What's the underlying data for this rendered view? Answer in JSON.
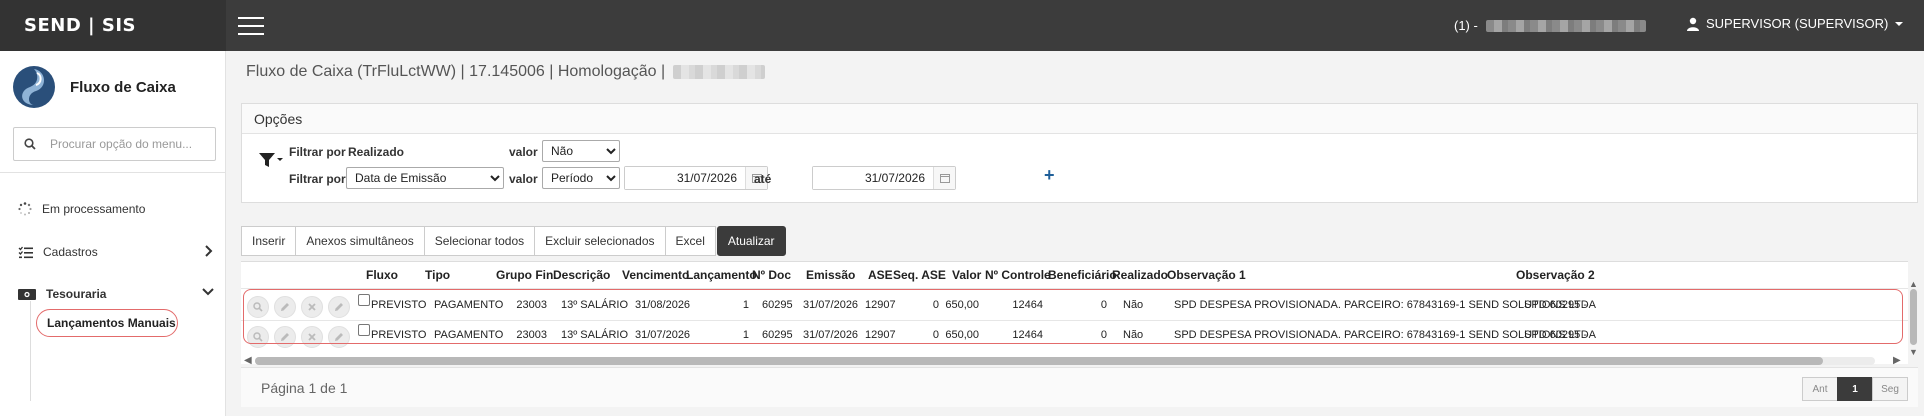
{
  "topbar": {
    "brand": "SEND | SIS",
    "environment_prefix": "(1) -",
    "user_label": "SUPERVISOR (SUPERVISOR)"
  },
  "sidebar": {
    "module_title": "Fluxo de Caixa",
    "search_placeholder": "Procurar opção do menu...",
    "items": [
      {
        "label": "Em processamento",
        "icon": "spinner-icon"
      },
      {
        "label": "Cadastros",
        "icon": "list-check-icon",
        "expanded": false
      },
      {
        "label": "Tesouraria",
        "icon": "money-bill-icon",
        "expanded": true
      }
    ],
    "subitems": [
      {
        "label": "Lançamentos Manuais",
        "highlighted": true
      }
    ]
  },
  "page": {
    "title": "Fluxo de Caixa (TrFluLctWW) | 17.145006 | Homologação |"
  },
  "options": {
    "header": "Opções",
    "filter1": {
      "label": "Filtrar por",
      "field": "Realizado",
      "value_label": "valor",
      "value": "Não"
    },
    "filter2": {
      "label": "Filtrar por",
      "field": "Data de Emissão",
      "value_label": "valor",
      "value": "Período",
      "date_from": "31/07/2026",
      "until_label": "até",
      "date_to": "31/07/2026"
    },
    "add_symbol": "+"
  },
  "toolbar": {
    "buttons": [
      "Inserir",
      "Anexos simultâneos",
      "Selecionar todos",
      "Excluir selecionados",
      "Excel",
      "Atualizar"
    ],
    "active": "Atualizar"
  },
  "grid": {
    "columns": [
      "Fluxo",
      "Tipo",
      "Grupo Fin.",
      "Descrição",
      "Vencimento",
      "Lançamento",
      "Nº Doc",
      "Emissão",
      "ASE",
      "Seq. ASE",
      "Valor",
      "Nº Controle",
      "Beneficiário",
      "Realizado",
      "Observação 1",
      "Observação 2"
    ],
    "rows": [
      [
        "PREVISTO",
        "PAGAMENTO",
        "23003",
        "13º SALÁRIO",
        "31/08/2026",
        "1",
        "60295",
        "31/07/2026",
        "12907",
        "0",
        "650,00",
        "12464",
        "0",
        "Não",
        "SPD DESPESA PROVISIONADA. PARCEIRO: 67843169-1 SEND SOLUTIONS LTDA",
        "SPD 60295 -"
      ],
      [
        "PREVISTO",
        "PAGAMENTO",
        "23003",
        "13º SALÁRIO",
        "31/07/2026",
        "1",
        "60295",
        "31/07/2026",
        "12907",
        "0",
        "650,00",
        "12464",
        "0",
        "Não",
        "SPD DESPESA PROVISIONADA. PARCEIRO: 67843169-1 SEND SOLUTIONS LTDA",
        "SPD 60295 -"
      ]
    ],
    "row_actions": [
      "search-icon",
      "edit-icon",
      "delete-icon",
      "edit-alt-icon"
    ]
  },
  "pagination": {
    "info": "Página 1 de 1",
    "prev": "Ant",
    "current": "1",
    "next": "Seg"
  },
  "colors": {
    "topbar": "#3c3c3c",
    "brand_bg": "#333333",
    "highlight": "#e36b6b",
    "active_button": "#3b3b3b",
    "plus": "#1f5f99"
  }
}
